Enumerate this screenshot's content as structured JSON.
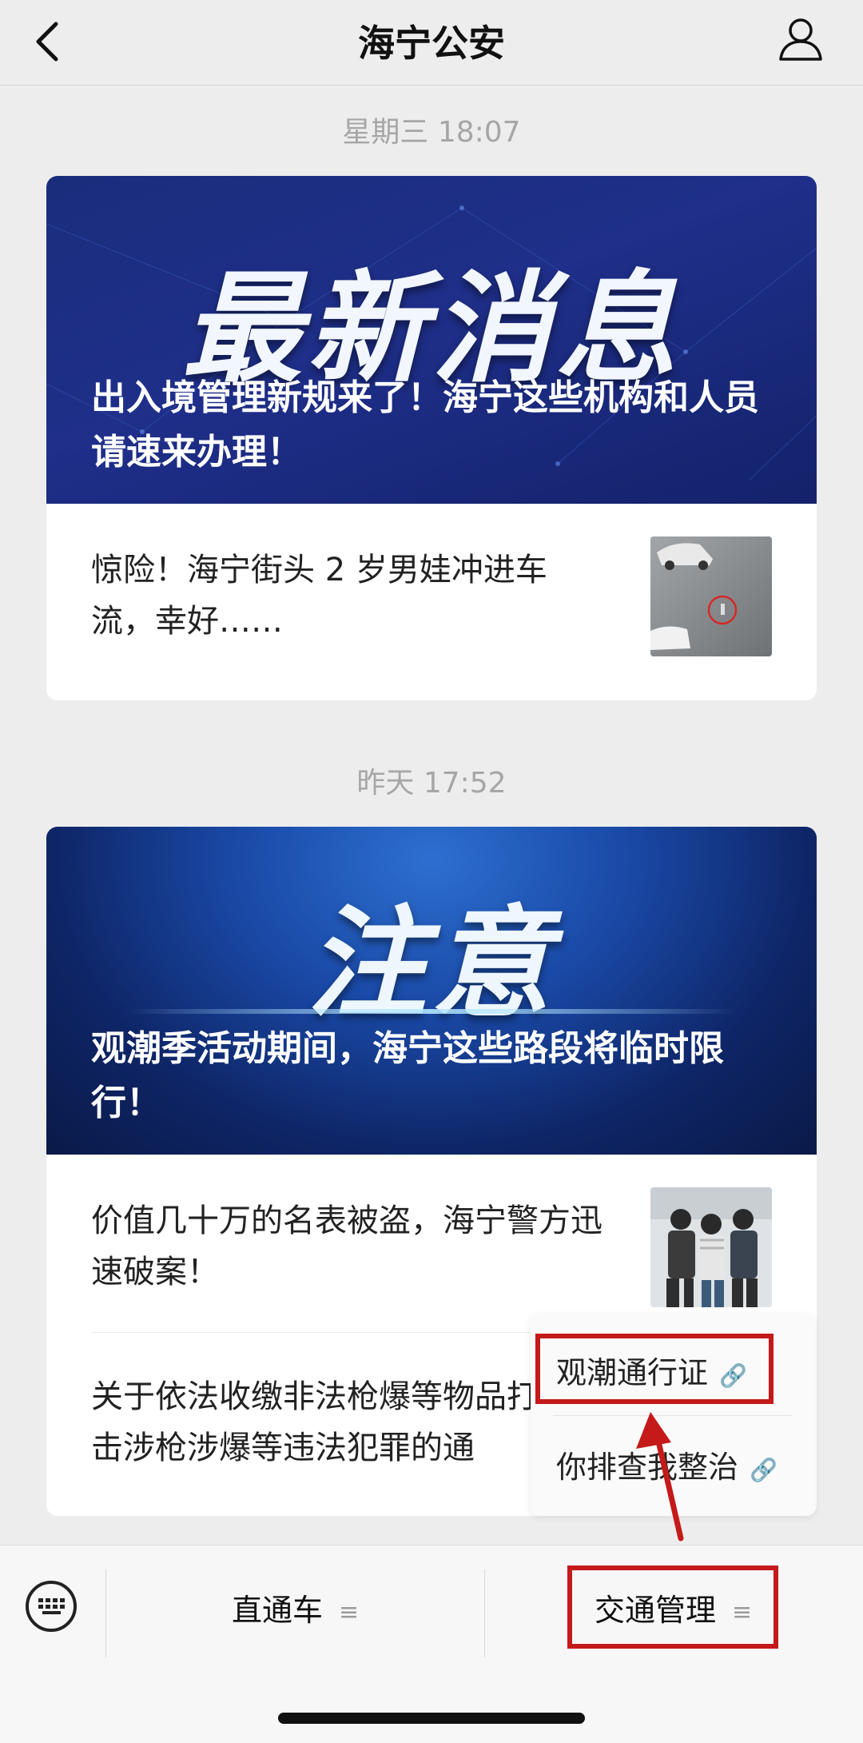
{
  "nav": {
    "title": "海宁公安"
  },
  "groups": [
    {
      "time": "星期三 18:07",
      "banner_word": "最新消息",
      "banner_title": "出入境管理新规来了！海宁这些机构和人员请速来办理！",
      "items": [
        {
          "text": "惊险！海宁街头 2 岁男娃冲进车流，幸好……"
        }
      ]
    },
    {
      "time": "昨天 17:52",
      "banner_word": "注意",
      "banner_title": "观潮季活动期间，海宁这些路段将临时限行！",
      "items": [
        {
          "text": "价值几十万的名表被盗，海宁警方迅速破案！"
        },
        {
          "text": "关于依法收缴非法枪爆等物品打击涉枪涉爆等违法犯罪的通"
        }
      ]
    }
  ],
  "popup": {
    "items": [
      "观潮通行证",
      "你排查我整治"
    ]
  },
  "tabbar": {
    "tabs": [
      "直通车",
      "交通管理"
    ]
  },
  "colors": {
    "highlight": "#c41a1a",
    "banner1": "#1f2f8a",
    "banner2": "#1a4aa8"
  }
}
